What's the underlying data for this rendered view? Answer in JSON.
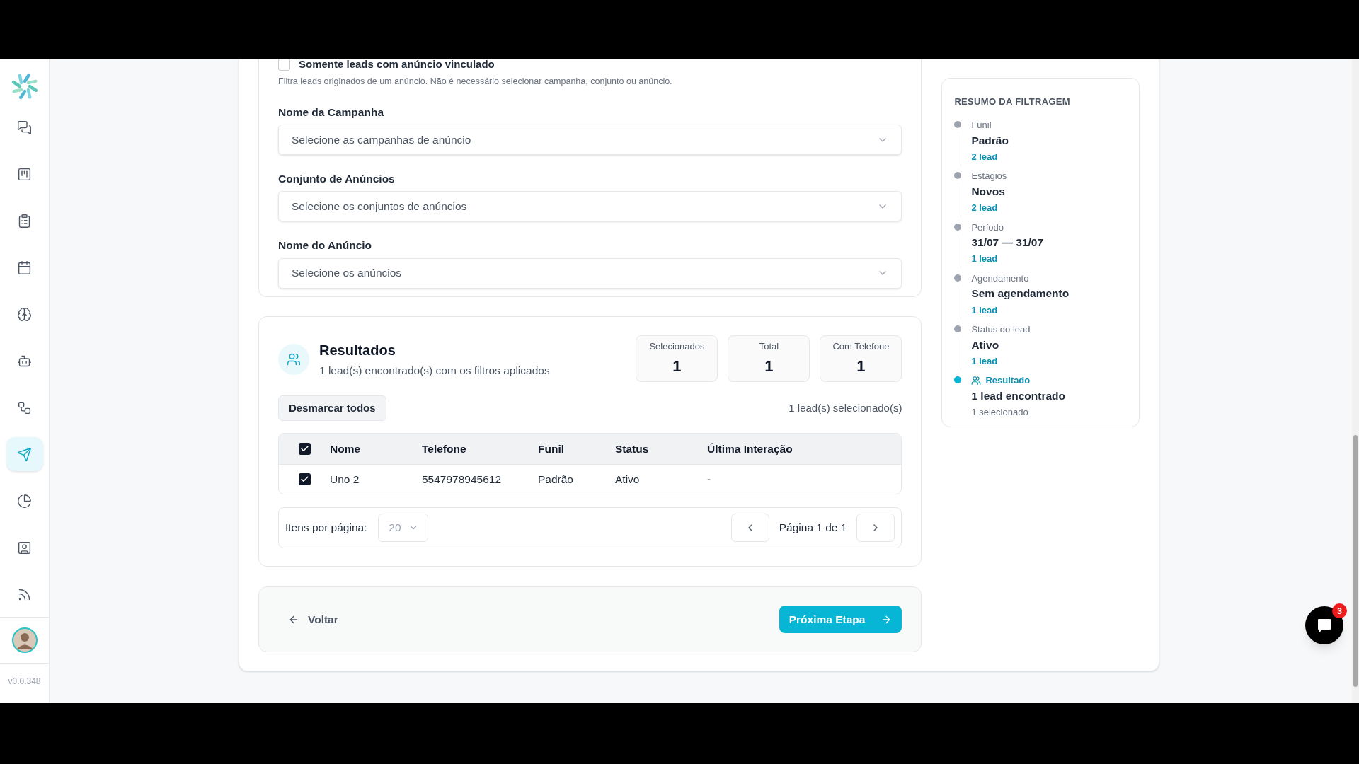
{
  "sidebar": {
    "items": [
      {
        "selected": false
      },
      {
        "selected": false
      },
      {
        "selected": false
      },
      {
        "selected": false
      },
      {
        "selected": false
      },
      {
        "selected": false
      },
      {
        "selected": false
      },
      {
        "selected": true
      },
      {
        "selected": false
      },
      {
        "selected": false
      },
      {
        "selected": false
      }
    ],
    "version": "v0.0.348"
  },
  "ad_filter": {
    "label": "Somente leads com anúncio vinculado",
    "checked": false,
    "hint": "Filtra leads originados de um anúncio. Não é necessário selecionar campanha, conjunto ou anúncio."
  },
  "fields": [
    {
      "label": "Nome da Campanha",
      "placeholder": "Selecione as campanhas de anúncio"
    },
    {
      "label": "Conjunto de Anúncios",
      "placeholder": "Selecione os conjuntos de anúncios"
    },
    {
      "label": "Nome do Anúncio",
      "placeholder": "Selecione os anúncios"
    }
  ],
  "results": {
    "title": "Resultados",
    "subtitle": "1 lead(s) encontrado(s) com os filtros aplicados",
    "stats": [
      {
        "label": "Selecionados",
        "value": "1"
      },
      {
        "label": "Total",
        "value": "1"
      },
      {
        "label": "Com Telefone",
        "value": "1"
      }
    ],
    "clear_button": "Desmarcar todos",
    "selected_count": "1 lead(s) selecionado(s)",
    "table": {
      "all_checked": true,
      "columns": [
        "Nome",
        "Telefone",
        "Funil",
        "Status",
        "Última Interação"
      ],
      "rows": [
        {
          "checked": true,
          "cells": [
            "Uno 2",
            "5547978945612",
            "Padrão",
            "Ativo",
            "-"
          ]
        }
      ]
    },
    "pagination": {
      "label": "Itens por página:",
      "page_size": "20",
      "page_text": "Página 1 de 1"
    }
  },
  "footer": {
    "back": "Voltar",
    "next": "Próxima Etapa"
  },
  "summary": {
    "title": "RESUMO DA FILTRAGEM",
    "steps": [
      {
        "kind": "filter",
        "label": "Funil",
        "value": "Padrão",
        "count": "2 lead"
      },
      {
        "kind": "filter",
        "label": "Estágios",
        "value": "Novos",
        "count": "2 lead"
      },
      {
        "kind": "filter",
        "label": "Período",
        "value": "31/07 — 31/07",
        "count": "1 lead"
      },
      {
        "kind": "filter",
        "label": "Agendamento",
        "value": "Sem agendamento",
        "count": "1 lead"
      },
      {
        "kind": "filter",
        "label": "Status do lead",
        "value": "Ativo",
        "count": "1 lead"
      },
      {
        "kind": "result",
        "label": "Resultado",
        "value": "1 lead encontrado",
        "count": "1 selecionado"
      }
    ]
  },
  "chat": {
    "badge": "3"
  }
}
